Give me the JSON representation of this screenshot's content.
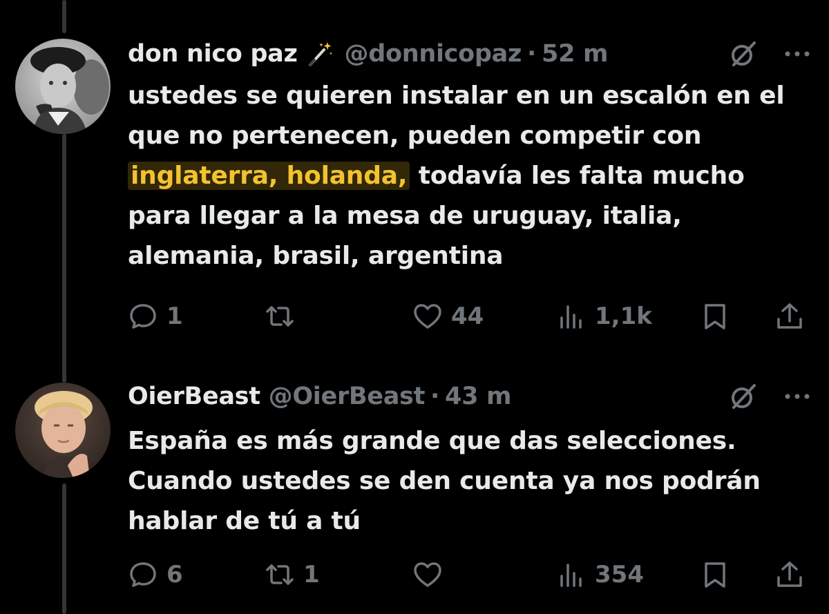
{
  "tweets": [
    {
      "display_name": "don nico paz",
      "handle": "@donnicopaz",
      "dot": "·",
      "time": "52 m",
      "text_before": "ustedes se quieren instalar en un escalón en el que no pertenecen, pueden competir con ",
      "text_highlight": "inglaterra, holanda,",
      "text_after": " todavía les falta mucho para llegar a la mesa de uruguay, italia, alemania, brasil, argentina",
      "actions": {
        "replies": "1",
        "retweets": "",
        "likes": "44",
        "views": "1,1k"
      }
    },
    {
      "display_name": "OierBeast",
      "handle": "@OierBeast",
      "dot": "·",
      "time": "43 m",
      "text": "España es más grande que das selecciones. Cuando ustedes se den cuenta ya nos podrán hablar de tú a tú",
      "actions": {
        "replies": "6",
        "retweets": "1",
        "likes": "",
        "views": "354"
      }
    }
  ],
  "colors": {
    "background": "#000000",
    "text": "#e7e9ea",
    "muted": "#71767b",
    "highlight": "#f2c230",
    "thread_line": "#333639"
  },
  "icons": [
    "magic-wand-icon",
    "grok-icon",
    "more-icon",
    "reply-icon",
    "retweet-icon",
    "like-icon",
    "views-icon",
    "bookmark-icon",
    "share-icon"
  ]
}
